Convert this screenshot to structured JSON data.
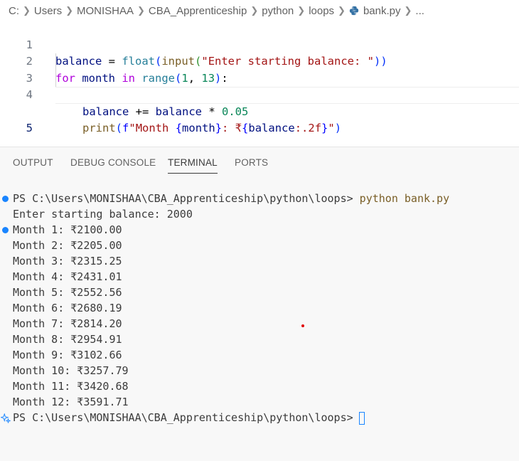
{
  "breadcrumb": {
    "drive": "C:",
    "segments": [
      "Users",
      "MONISHAA",
      "CBA_Apprenticeship",
      "python",
      "loops"
    ],
    "file": "bank.py",
    "more": "..."
  },
  "editor": {
    "line_numbers": [
      "1",
      "2",
      "3",
      "4",
      "5"
    ],
    "code": {
      "l1": {
        "var": "balance",
        "eq": " = ",
        "float": "float",
        "p1": "(",
        "input": "input",
        "p2": "(",
        "str": "\"Enter starting balance: \"",
        "p3": "))"
      },
      "l2": {
        "for": "for",
        "month": " month ",
        "in": "in",
        "range": " range",
        "p1": "(",
        "a": "1",
        "comma": ", ",
        "b": "13",
        "p2": ")",
        "colon": ":"
      },
      "l3": {
        "var": "balance",
        "op": " += ",
        "var2": "balance",
        "mul": " * ",
        "num": "0.05"
      },
      "l4": {
        "print": "print",
        "p1": "(",
        "f": "f",
        "s1": "\"Month ",
        "b1": "{",
        "v1": "month",
        "b2": "}",
        "s2": ": ₹",
        "b3": "{",
        "v2": "balance",
        "fmt": ":.2f",
        "b4": "}",
        "s3": "\"",
        "p2": ")"
      }
    }
  },
  "panel_tabs": [
    "OUTPUT",
    "DEBUG CONSOLE",
    "TERMINAL",
    "PORTS"
  ],
  "terminal": {
    "prompt": "PS C:\\Users\\MONISHAA\\CBA_Apprenticeship\\python\\loops>",
    "command": "python bank.py",
    "lines": [
      "Enter starting balance: 2000",
      "Month 1: ₹2100.00",
      "Month 2: ₹2205.00",
      "Month 3: ₹2315.25",
      "Month 4: ₹2431.01",
      "Month 5: ₹2552.56",
      "Month 6: ₹2680.19",
      "Month 7: ₹2814.20",
      "Month 8: ₹2954.91",
      "Month 9: ₹3102.66",
      "Month 10: ₹3257.79",
      "Month 11: ₹3420.68",
      "Month 12: ₹3591.71"
    ],
    "final_prompt": "PS C:\\Users\\MONISHAA\\CBA_Apprenticeship\\python\\loops>"
  },
  "colors": {
    "accent": "#1a85ff",
    "keyword": "#0000ff",
    "control": "#af00db",
    "function": "#795e26",
    "string": "#a31515",
    "number": "#098658"
  }
}
